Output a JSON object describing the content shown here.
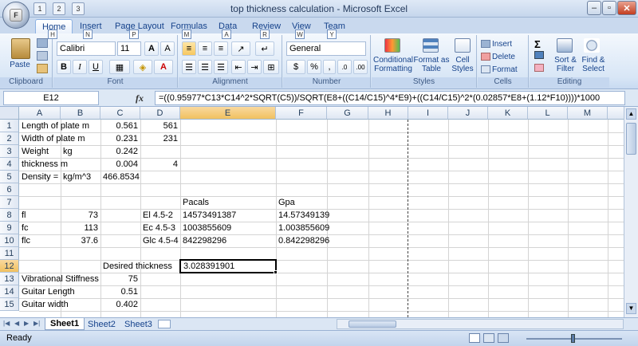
{
  "app": {
    "title": "top thickness calculation - Microsoft Excel",
    "office_button": "F",
    "qat": [
      "1",
      "2",
      "3"
    ],
    "window_buttons": [
      "–",
      "▫",
      "✕"
    ]
  },
  "tabs": [
    {
      "label": "Home",
      "keytip": "H"
    },
    {
      "label": "Insert",
      "keytip": "N"
    },
    {
      "label": "Page Layout",
      "keytip": "P"
    },
    {
      "label": "Formulas",
      "keytip": "M"
    },
    {
      "label": "Data",
      "keytip": "A"
    },
    {
      "label": "Review",
      "keytip": "R"
    },
    {
      "label": "View",
      "keytip": "W"
    },
    {
      "label": "Team",
      "keytip": "Y"
    }
  ],
  "ribbon": {
    "clipboard": {
      "label": "Clipboard",
      "paste": "Paste"
    },
    "font": {
      "label": "Font",
      "name": "Calibri",
      "size": "11"
    },
    "alignment": {
      "label": "Alignment"
    },
    "number": {
      "label": "Number",
      "format": "General"
    },
    "styles": {
      "label": "Styles",
      "conditional": "Conditional Formatting",
      "format_table": "Format as Table",
      "cell_styles": "Cell Styles"
    },
    "cells": {
      "label": "Cells",
      "insert": "Insert",
      "delete": "Delete",
      "format": "Format"
    },
    "editing": {
      "label": "Editing",
      "sort": "Sort & Filter",
      "find": "Find & Select"
    }
  },
  "formula_bar": {
    "name_box": "E12",
    "fx": "fx",
    "formula": "=((0.95977*C13*C14^2*SQRT(C5))/SQRT(E8+((C14/C15)^4*E9)+((C14/C15)^2*(0.02857*E8+(1.12*F10))))*1000"
  },
  "columns": [
    "A",
    "B",
    "C",
    "D",
    "E",
    "F",
    "G",
    "H",
    "I",
    "J",
    "K",
    "L",
    "M"
  ],
  "rows": [
    "1",
    "2",
    "3",
    "4",
    "5",
    "6",
    "7",
    "8",
    "9",
    "10",
    "11",
    "12",
    "13",
    "14",
    "15"
  ],
  "cells": {
    "A1": "Length of plate m",
    "C1": "0.561",
    "D1": "561",
    "A2": "Width of plate m",
    "C2": "0.231",
    "D2": "231",
    "A3": "Weight",
    "B3": "kg",
    "C3": "0.242",
    "A4": "thickness m",
    "C4": "0.004",
    "D4": "4",
    "A5": "Density =",
    "B5": "kg/m^3",
    "C5": "466.8534",
    "E7": "Pacals",
    "F7": "Gpa",
    "A8": "fl",
    "B8": "73",
    "D8": "El 4.5-2",
    "E8": "14573491387",
    "F8": "14.57349139",
    "A9": "fc",
    "B9": "113",
    "D9": "Ec 4.5-3",
    "E9": "1003855609",
    "F9": "1.003855609",
    "A10": "flc",
    "B10": "37.6",
    "D10": "Glc 4.5-4",
    "E10": "842298296",
    "F10": "0.842298296",
    "C12": "Desired thickness",
    "E12": "3.028391901",
    "A13": "Vibrational Stiffness",
    "C13": "75",
    "A14": "Guitar Length",
    "C14": "0.51",
    "A15": "Guitar width",
    "C15": "0.402"
  },
  "sheets": [
    "Sheet1",
    "Sheet2",
    "Sheet3"
  ],
  "status": "Ready"
}
